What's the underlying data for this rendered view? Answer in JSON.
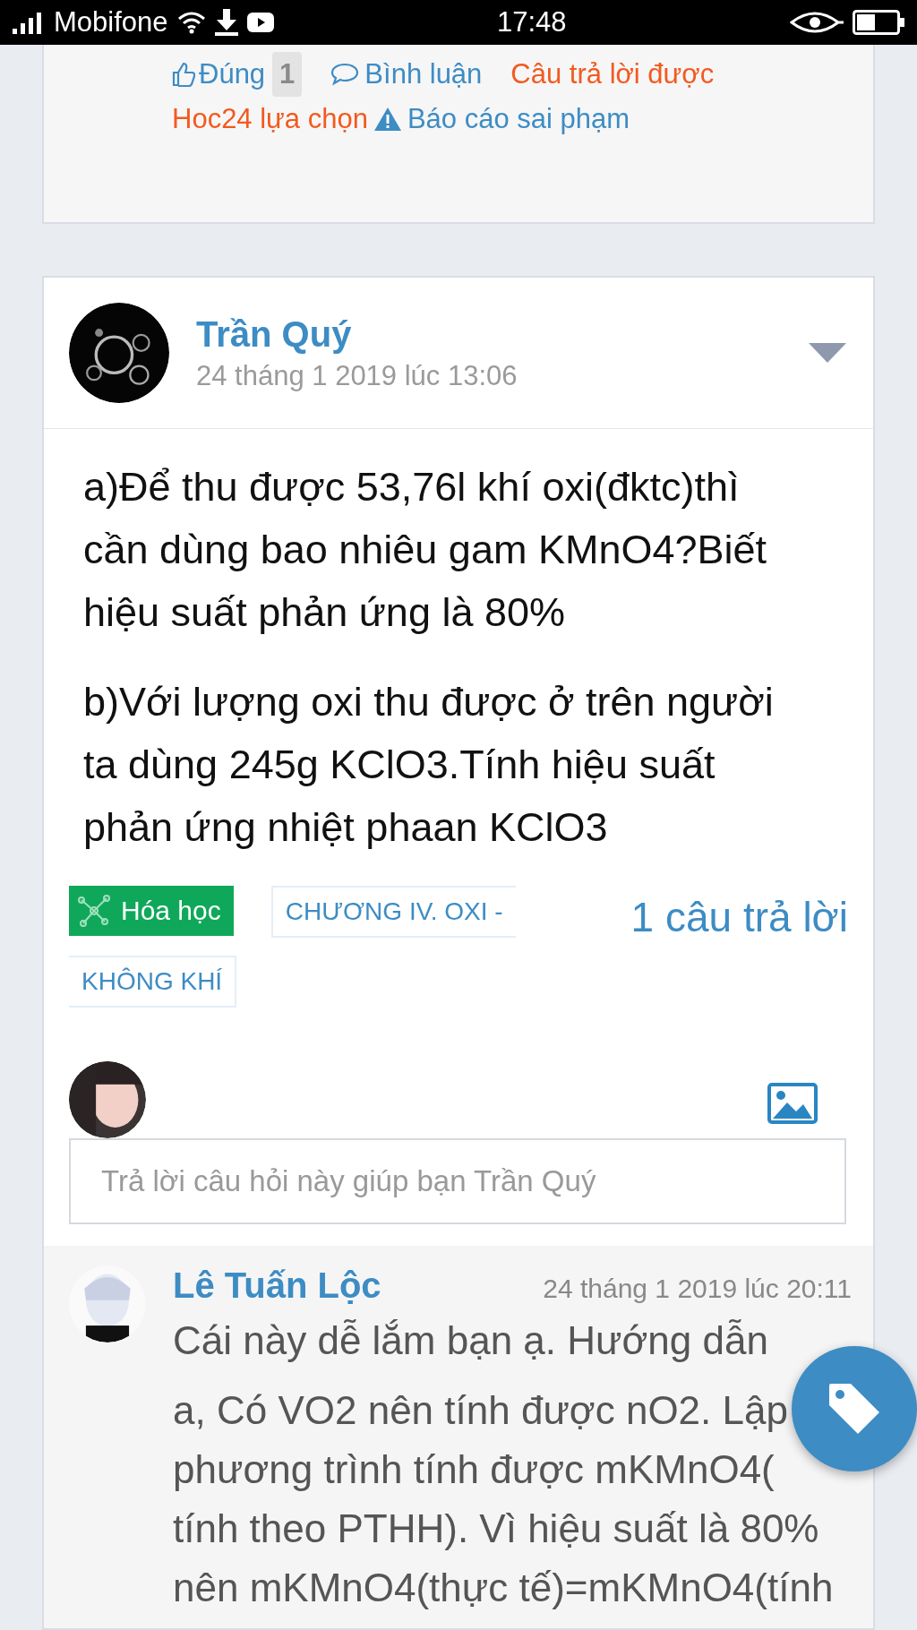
{
  "status_bar": {
    "carrier": "Mobifone",
    "time": "17:48"
  },
  "previous_answer": {
    "actions": [
      {
        "kind": "vote",
        "label": "Đúng",
        "count": "1"
      },
      {
        "kind": "comment",
        "label": "Bình luận"
      },
      {
        "kind": "chosen",
        "label": "Câu trả lời được"
      },
      {
        "kind": "break"
      },
      {
        "kind": "chosen",
        "label": "Hoc24 lựa chọn"
      },
      {
        "kind": "report",
        "label": "Báo cáo sai phạm"
      }
    ]
  },
  "question": {
    "author": "Trần Quý",
    "date": "24 tháng 1 2019 lúc 13:06",
    "paragraphs": [
      "a)Để thu được 53,76l khí oxi(đktc)thì cần dùng bao nhiêu gam KMnO4?Biết hiệu suất phản ứng là 80%",
      "b)Với lượng oxi thu được ở trên người ta dùng 245g KClO3.Tính hiệu suất phản ứng nhiệt phaan KClO3"
    ],
    "subject_tag": "Hóa học",
    "chapter_tag": [
      "CHƯƠNG IV. OXI -",
      "KHÔNG KHÍ"
    ],
    "answer_count": "1 câu trả lời",
    "reply_placeholder": "Trả lời câu hỏi này giúp bạn Trần Quý"
  },
  "answer": {
    "author": "Lê Tuấn Lộc",
    "date": "24 tháng 1 2019 lúc 20:11",
    "paragraphs": [
      "Cái này dễ lắm bạn ạ. Hướng dẫn",
      "a, Có VO2 nên tính được nO2. Lập phương trình tính được mKMnO4( tính theo PTHH). Vì hiệu suất là 80% nên mKMnO4(thực tế)=mKMnO4(tính"
    ]
  }
}
